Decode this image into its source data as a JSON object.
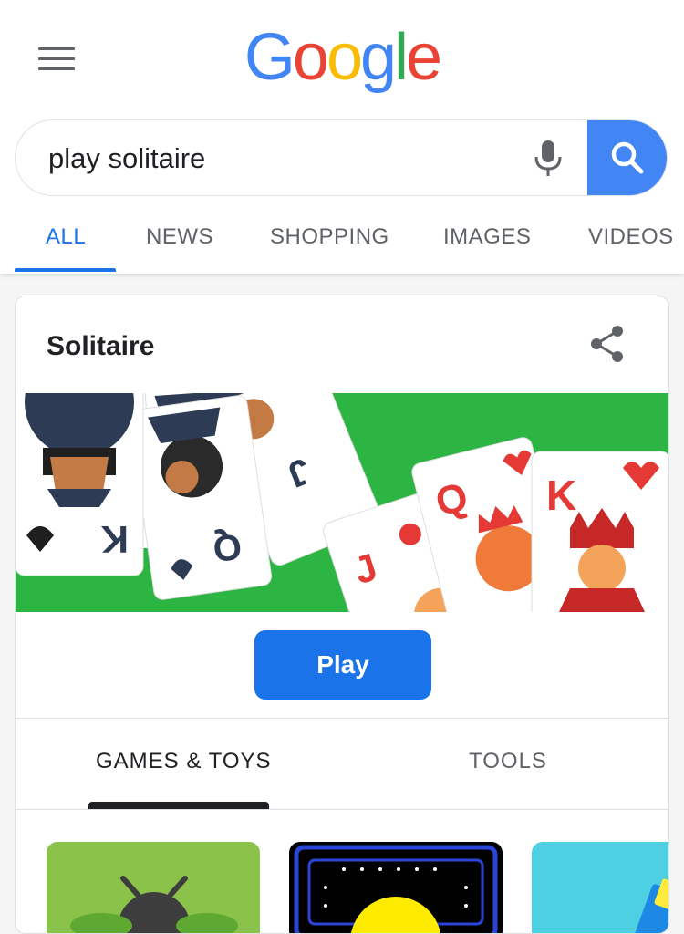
{
  "header": {
    "logo_letters": [
      {
        "ch": "G",
        "color": "#4285f4"
      },
      {
        "ch": "o",
        "color": "#ea4335"
      },
      {
        "ch": "o",
        "color": "#fbbc05"
      },
      {
        "ch": "g",
        "color": "#4285f4"
      },
      {
        "ch": "l",
        "color": "#34a853"
      },
      {
        "ch": "e",
        "color": "#ea4335"
      }
    ]
  },
  "search": {
    "query": "play solitaire"
  },
  "tabs": {
    "items": [
      {
        "label": "ALL",
        "active": true
      },
      {
        "label": "NEWS",
        "active": false
      },
      {
        "label": "SHOPPING",
        "active": false
      },
      {
        "label": "IMAGES",
        "active": false
      },
      {
        "label": "VIDEOS",
        "active": false
      }
    ]
  },
  "card": {
    "title": "Solitaire",
    "play_label": "Play",
    "subtabs": [
      {
        "label": "GAMES & TOYS",
        "active": true
      },
      {
        "label": "TOOLS",
        "active": false
      }
    ],
    "banner_cards": [
      "K",
      "Q",
      "J",
      "J",
      "Q",
      "K"
    ]
  },
  "colors": {
    "accent": "#1a73e8",
    "search_button": "#4285f4",
    "banner_green": "#2db543",
    "card_red": "#e53935",
    "card_navy": "#2e3b55"
  },
  "icons": [
    "menu-icon",
    "mic-icon",
    "search-icon",
    "share-icon"
  ]
}
